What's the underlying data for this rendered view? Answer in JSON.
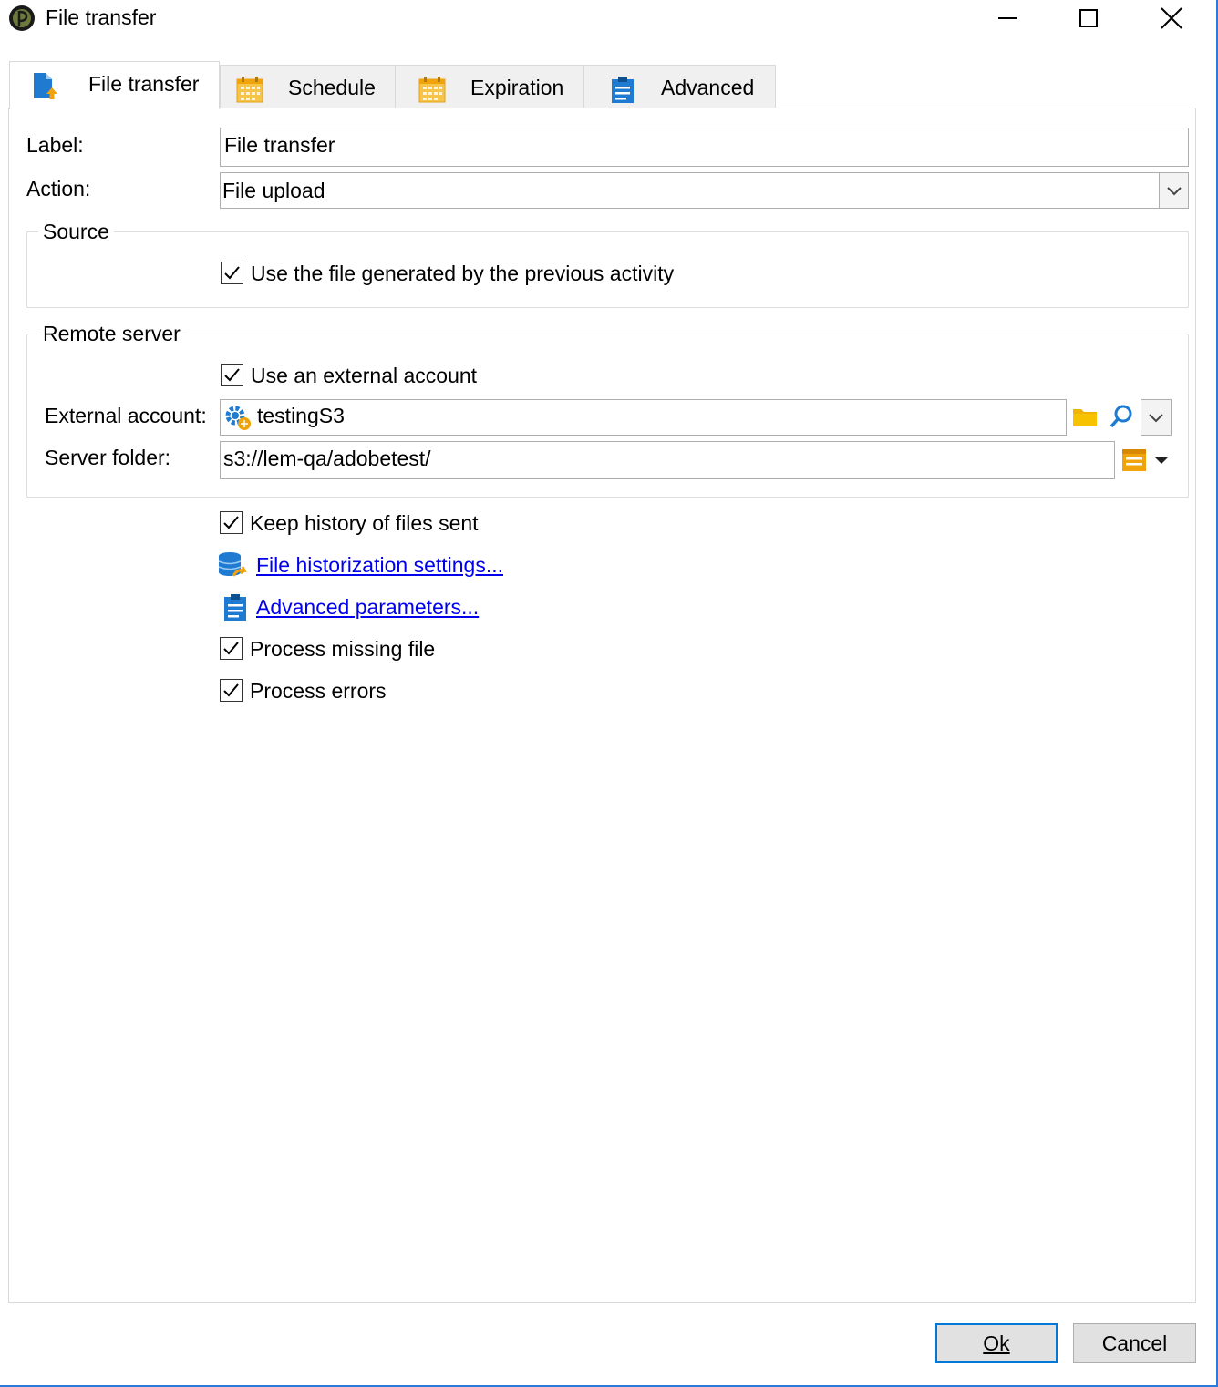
{
  "window": {
    "title": "File transfer"
  },
  "tabs": [
    {
      "label": "File transfer",
      "icon": "file-upload-icon",
      "active": true
    },
    {
      "label": "Schedule",
      "icon": "calendar-icon",
      "active": false
    },
    {
      "label": "Expiration",
      "icon": "calendar-icon",
      "active": false
    },
    {
      "label": "Advanced",
      "icon": "clipboard-icon",
      "active": false
    }
  ],
  "form": {
    "label_caption": "Label:",
    "label_value": "File transfer",
    "action_caption": "Action:",
    "action_value": "File upload",
    "source": {
      "title": "Source",
      "use_previous_label": "Use the file generated by the previous activity",
      "use_previous_checked": true
    },
    "remote": {
      "title": "Remote server",
      "use_external_label": "Use an external account",
      "use_external_checked": true,
      "external_caption": "External account:",
      "external_value": "testingS3",
      "folder_caption": "Server folder:",
      "folder_value": "s3://lem-qa/adobetest/"
    },
    "keep_history_label": "Keep history of files sent",
    "keep_history_checked": true,
    "historization_link": "File historization settings...",
    "advanced_link": "Advanced parameters...",
    "process_missing_label": "Process missing file",
    "process_missing_checked": true,
    "process_errors_label": "Process errors",
    "process_errors_checked": true
  },
  "footer": {
    "ok_label": "Ok",
    "cancel_label": "Cancel"
  },
  "colors": {
    "accent": "#0078d7",
    "link": "#0000ee",
    "icon_blue": "#1e7bd1",
    "icon_orange": "#f0a30a"
  }
}
